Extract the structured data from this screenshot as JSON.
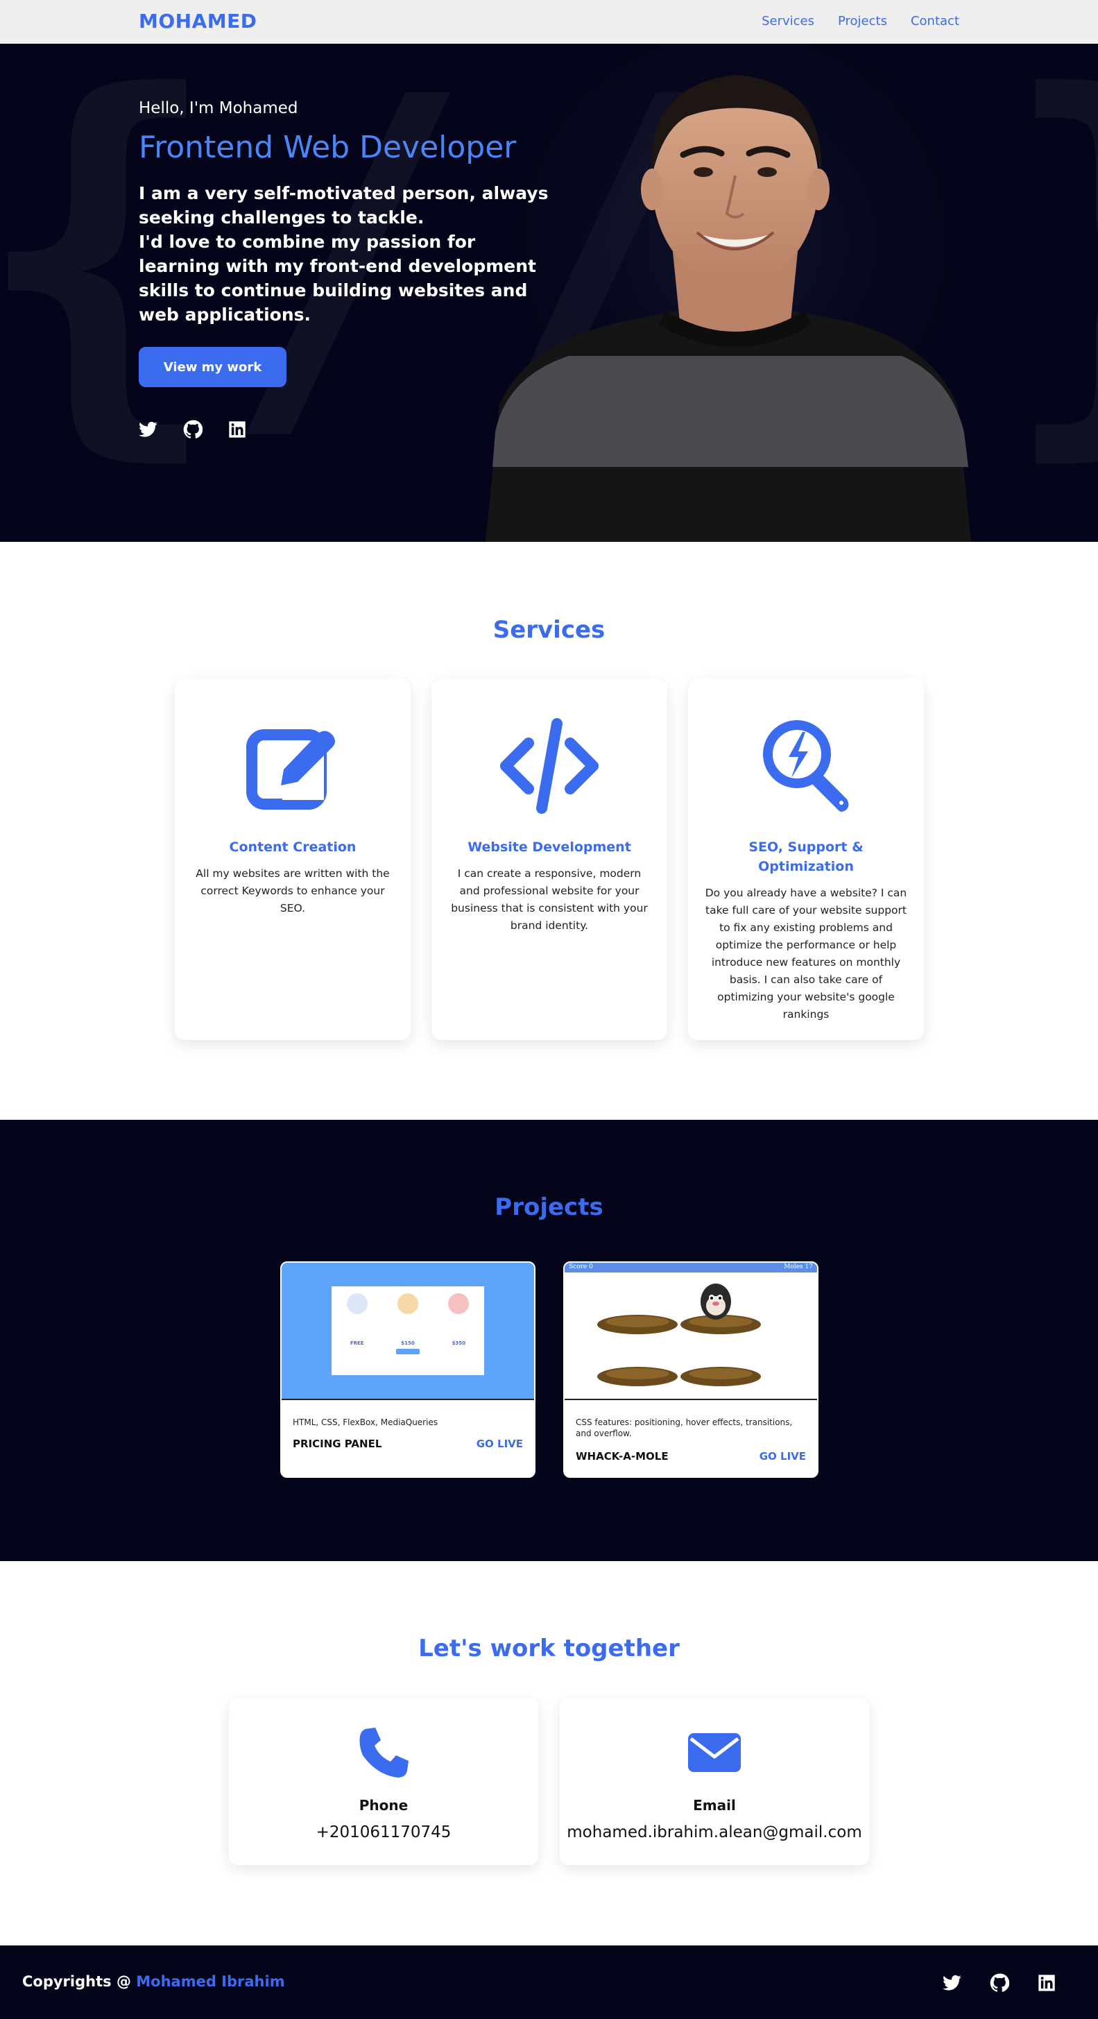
{
  "nav": {
    "brand": "MOHAMED",
    "links": [
      "Services",
      "Projects",
      "Contact"
    ]
  },
  "hero": {
    "greeting": "Hello, I'm Mohamed",
    "role": "Frontend Web Developer",
    "intro_line1": "I am a very self-motivated person, always seeking challenges to tackle.",
    "intro_line2": "I'd love to combine my passion for learning with my front-end development skills to continue building websites and web applications.",
    "cta": "View my work",
    "social_icons": [
      "twitter-icon",
      "github-icon",
      "linkedin-icon"
    ]
  },
  "services": {
    "title": "Services",
    "items": [
      {
        "icon": "edit-icon",
        "title": "Content Creation",
        "text": "All my websites are written with the correct Keywords to enhance your SEO."
      },
      {
        "icon": "code-icon",
        "title": "Website Development",
        "text": "I can create a responsive, modern and professional website for your business that is consistent with your brand identity."
      },
      {
        "icon": "seo-search-icon",
        "title": "SEO, Support & Optimization",
        "text": "Do you already have a website? I can take full care of your website support to fix any existing problems and optimize the performance or help introduce new features on monthly basis. I can also take care of optimizing your website's google rankings"
      }
    ]
  },
  "projects": {
    "title": "Projects",
    "items": [
      {
        "desc": "HTML, CSS, FlexBox, MediaQueries",
        "name": "PRICING PANEL",
        "live": "GO LIVE",
        "thumb": {
          "prices": [
            "FREE",
            "$150",
            "$350"
          ]
        }
      },
      {
        "desc": "CSS features: positioning, hover effects, transitions, and overflow.",
        "name": "WHACK-A-MOLE",
        "live": "GO LIVE",
        "thumb": {
          "score": "Score 0",
          "moles": "Moles 17"
        }
      }
    ]
  },
  "contact": {
    "title": "Let's work together",
    "items": [
      {
        "icon": "phone-icon",
        "label": "Phone",
        "value": "+201061170745"
      },
      {
        "icon": "email-icon",
        "label": "Email",
        "value": "mohamed.ibrahim.alean@gmail.com"
      }
    ]
  },
  "footer": {
    "copy_prefix": "Copyrights @ ",
    "author": "Mohamed Ibrahim",
    "social_icons": [
      "twitter-icon",
      "github-icon",
      "linkedin-icon"
    ]
  },
  "colors": {
    "accent": "#3b6cf0",
    "dark_bg": "#04051a",
    "nav_bg": "#efefef"
  }
}
